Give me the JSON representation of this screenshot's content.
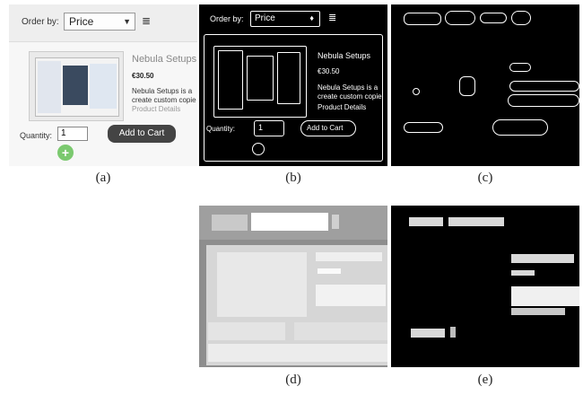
{
  "panels": {
    "a": {
      "caption": "(a)",
      "order_label": "Order by:",
      "order_value": "Price",
      "sort_icon": "sort-icon",
      "product_title": "Nebula Setups",
      "product_price": "€30.50",
      "product_desc_1": "Nebula Setups is a",
      "product_desc_2": "create custom copie",
      "product_link": "Product Details",
      "quantity_label": "Quantity:",
      "quantity_value": "1",
      "add_to_cart": "Add to Cart",
      "plus_icon": "add-icon",
      "colors": {
        "button": "#444444",
        "plus": "#7bc96f",
        "title": "#888888"
      }
    },
    "b": {
      "caption": "(b)",
      "order_label": "Order by:",
      "order_value": "Price",
      "product_title": "Nebula Setups",
      "product_price": "€30.50",
      "product_desc_1": "Nebula Setups is a",
      "product_desc_2": "create custom copie",
      "product_link": "Product Details",
      "quantity_label": "Quantity:",
      "quantity_value": "1",
      "add_to_cart": "Add to Cart"
    },
    "c": {
      "caption": "(c)"
    },
    "d": {
      "caption": "(d)"
    },
    "e": {
      "caption": "(e)"
    }
  }
}
